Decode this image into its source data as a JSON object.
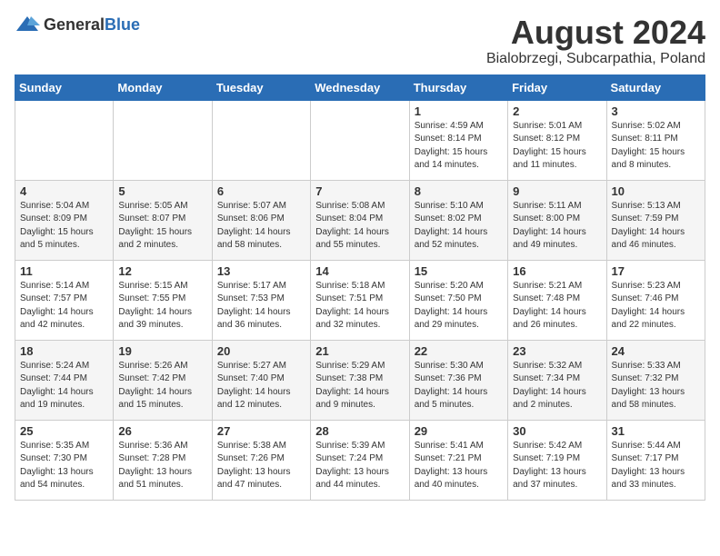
{
  "logo": {
    "general": "General",
    "blue": "Blue"
  },
  "title": "August 2024",
  "subtitle": "Bialobrzegi, Subcarpathia, Poland",
  "weekdays": [
    "Sunday",
    "Monday",
    "Tuesday",
    "Wednesday",
    "Thursday",
    "Friday",
    "Saturday"
  ],
  "weeks": [
    [
      {
        "day": "",
        "info": ""
      },
      {
        "day": "",
        "info": ""
      },
      {
        "day": "",
        "info": ""
      },
      {
        "day": "",
        "info": ""
      },
      {
        "day": "1",
        "info": "Sunrise: 4:59 AM\nSunset: 8:14 PM\nDaylight: 15 hours\nand 14 minutes."
      },
      {
        "day": "2",
        "info": "Sunrise: 5:01 AM\nSunset: 8:12 PM\nDaylight: 15 hours\nand 11 minutes."
      },
      {
        "day": "3",
        "info": "Sunrise: 5:02 AM\nSunset: 8:11 PM\nDaylight: 15 hours\nand 8 minutes."
      }
    ],
    [
      {
        "day": "4",
        "info": "Sunrise: 5:04 AM\nSunset: 8:09 PM\nDaylight: 15 hours\nand 5 minutes."
      },
      {
        "day": "5",
        "info": "Sunrise: 5:05 AM\nSunset: 8:07 PM\nDaylight: 15 hours\nand 2 minutes."
      },
      {
        "day": "6",
        "info": "Sunrise: 5:07 AM\nSunset: 8:06 PM\nDaylight: 14 hours\nand 58 minutes."
      },
      {
        "day": "7",
        "info": "Sunrise: 5:08 AM\nSunset: 8:04 PM\nDaylight: 14 hours\nand 55 minutes."
      },
      {
        "day": "8",
        "info": "Sunrise: 5:10 AM\nSunset: 8:02 PM\nDaylight: 14 hours\nand 52 minutes."
      },
      {
        "day": "9",
        "info": "Sunrise: 5:11 AM\nSunset: 8:00 PM\nDaylight: 14 hours\nand 49 minutes."
      },
      {
        "day": "10",
        "info": "Sunrise: 5:13 AM\nSunset: 7:59 PM\nDaylight: 14 hours\nand 46 minutes."
      }
    ],
    [
      {
        "day": "11",
        "info": "Sunrise: 5:14 AM\nSunset: 7:57 PM\nDaylight: 14 hours\nand 42 minutes."
      },
      {
        "day": "12",
        "info": "Sunrise: 5:15 AM\nSunset: 7:55 PM\nDaylight: 14 hours\nand 39 minutes."
      },
      {
        "day": "13",
        "info": "Sunrise: 5:17 AM\nSunset: 7:53 PM\nDaylight: 14 hours\nand 36 minutes."
      },
      {
        "day": "14",
        "info": "Sunrise: 5:18 AM\nSunset: 7:51 PM\nDaylight: 14 hours\nand 32 minutes."
      },
      {
        "day": "15",
        "info": "Sunrise: 5:20 AM\nSunset: 7:50 PM\nDaylight: 14 hours\nand 29 minutes."
      },
      {
        "day": "16",
        "info": "Sunrise: 5:21 AM\nSunset: 7:48 PM\nDaylight: 14 hours\nand 26 minutes."
      },
      {
        "day": "17",
        "info": "Sunrise: 5:23 AM\nSunset: 7:46 PM\nDaylight: 14 hours\nand 22 minutes."
      }
    ],
    [
      {
        "day": "18",
        "info": "Sunrise: 5:24 AM\nSunset: 7:44 PM\nDaylight: 14 hours\nand 19 minutes."
      },
      {
        "day": "19",
        "info": "Sunrise: 5:26 AM\nSunset: 7:42 PM\nDaylight: 14 hours\nand 15 minutes."
      },
      {
        "day": "20",
        "info": "Sunrise: 5:27 AM\nSunset: 7:40 PM\nDaylight: 14 hours\nand 12 minutes."
      },
      {
        "day": "21",
        "info": "Sunrise: 5:29 AM\nSunset: 7:38 PM\nDaylight: 14 hours\nand 9 minutes."
      },
      {
        "day": "22",
        "info": "Sunrise: 5:30 AM\nSunset: 7:36 PM\nDaylight: 14 hours\nand 5 minutes."
      },
      {
        "day": "23",
        "info": "Sunrise: 5:32 AM\nSunset: 7:34 PM\nDaylight: 14 hours\nand 2 minutes."
      },
      {
        "day": "24",
        "info": "Sunrise: 5:33 AM\nSunset: 7:32 PM\nDaylight: 13 hours\nand 58 minutes."
      }
    ],
    [
      {
        "day": "25",
        "info": "Sunrise: 5:35 AM\nSunset: 7:30 PM\nDaylight: 13 hours\nand 54 minutes."
      },
      {
        "day": "26",
        "info": "Sunrise: 5:36 AM\nSunset: 7:28 PM\nDaylight: 13 hours\nand 51 minutes."
      },
      {
        "day": "27",
        "info": "Sunrise: 5:38 AM\nSunset: 7:26 PM\nDaylight: 13 hours\nand 47 minutes."
      },
      {
        "day": "28",
        "info": "Sunrise: 5:39 AM\nSunset: 7:24 PM\nDaylight: 13 hours\nand 44 minutes."
      },
      {
        "day": "29",
        "info": "Sunrise: 5:41 AM\nSunset: 7:21 PM\nDaylight: 13 hours\nand 40 minutes."
      },
      {
        "day": "30",
        "info": "Sunrise: 5:42 AM\nSunset: 7:19 PM\nDaylight: 13 hours\nand 37 minutes."
      },
      {
        "day": "31",
        "info": "Sunrise: 5:44 AM\nSunset: 7:17 PM\nDaylight: 13 hours\nand 33 minutes."
      }
    ]
  ]
}
